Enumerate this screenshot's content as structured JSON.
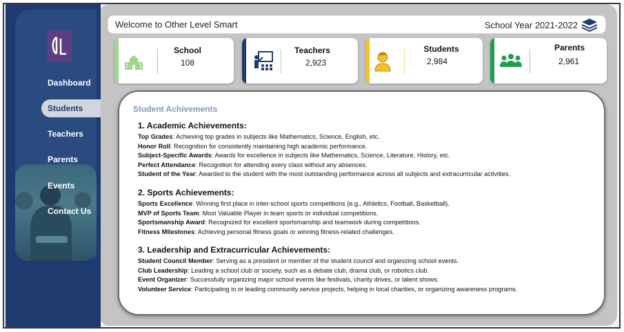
{
  "header": {
    "welcome": "Welcome to Other Level Smart",
    "school_year": "School Year 2021-2022"
  },
  "sidebar": {
    "items": [
      {
        "label": "Dashboard"
      },
      {
        "label": "Students"
      },
      {
        "label": "Teachers"
      },
      {
        "label": "Parents"
      },
      {
        "label": "Events"
      },
      {
        "label": "Contact Us"
      }
    ]
  },
  "cards": [
    {
      "label": "School",
      "value": "108",
      "icon": "school-building-icon",
      "accent": "#9fd58f"
    },
    {
      "label": "Teachers",
      "value": "2,923",
      "icon": "teacher-board-icon",
      "accent": "#1f3a6e"
    },
    {
      "label": "Students",
      "value": "2,984",
      "icon": "student-person-icon",
      "accent": "#f2c12e"
    },
    {
      "label": "Parents",
      "value": "2,961",
      "icon": "parents-group-icon",
      "accent": "#1e9e4e"
    }
  ],
  "content": {
    "title": "Student Achivements",
    "sections": [
      {
        "heading": "1. Academic Achievements:",
        "items": [
          {
            "term": "Top Grades",
            "text": ": Achieving top grades in subjects like Mathematics, Science, English, etc."
          },
          {
            "term": "Honor Roll",
            "text": ": Recognition for consistently maintaining high academic performance."
          },
          {
            "term": "Subject-Specific Awards",
            "text": ": Awards for excellence in subjects like Mathematics, Science, Literature, History, etc."
          },
          {
            "term": "Perfect Attendance",
            "text": ": Recognition for attending every class without any absences."
          },
          {
            "term": "Student of the Year",
            "text": ": Awarded to the student with the most outstanding performance across all subjects and extracurricular activities."
          }
        ]
      },
      {
        "heading": "2. Sports Achievements:",
        "items": [
          {
            "term": "Sports Excellence",
            "text": ": Winning first place in inter-school sports competitions (e.g., Athletics, Football, Basketball)."
          },
          {
            "term": "MVP of Sports Team",
            "text": ": Most Valuable Player in team sports or individual competitions."
          },
          {
            "term": "Sportsmanship Award",
            "text": ": Recognized for excellent sportsmanship and teamwork during competitions."
          },
          {
            "term": "Fitness Milestones",
            "text": ": Achieving personal fitness goals or winning fitness-related challenges."
          }
        ]
      },
      {
        "heading": "3. Leadership and Extracurricular Achievements:",
        "items": [
          {
            "term": "Student Council Member",
            "text": ": Serving as a president or member of the student council and organizing school events."
          },
          {
            "term": "Club Leadership",
            "text": ": Leading a school club or society, such as a debate club, drama club, or robotics club."
          },
          {
            "term": "Event Organizer",
            "text": ": Successfully organizing major school events like festivals, charity drives, or talent shows."
          },
          {
            "term": "Volunteer Service",
            "text": ": Participating in or leading community service projects, helping in local charities, or organizing awareness programs."
          }
        ]
      }
    ]
  }
}
